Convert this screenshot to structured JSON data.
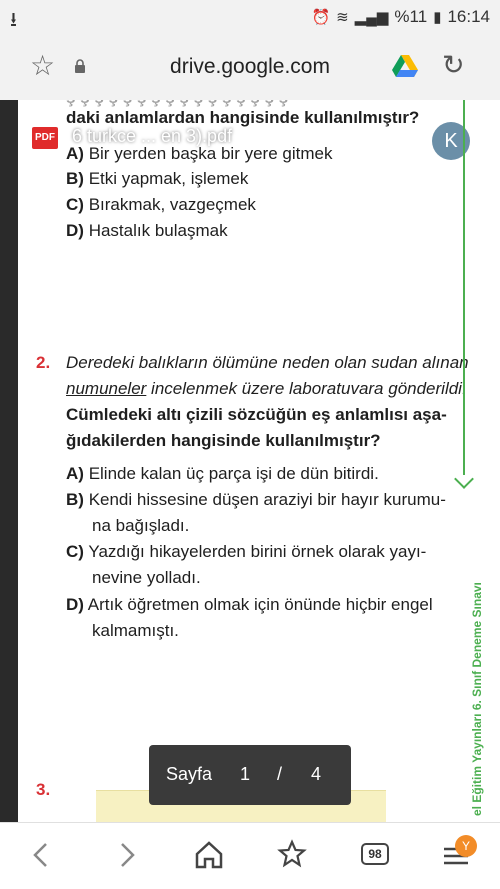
{
  "status_bar": {
    "left_icon": "download-arrow-icon",
    "battery_percent": "%11",
    "time": "16:14"
  },
  "browser": {
    "url": "drive.google.com"
  },
  "pdf": {
    "file_name": "6 turkce ... en 3).pdf",
    "badge": "PDF",
    "avatar_letter": "K"
  },
  "question1": {
    "stem_tail": "daki anlamlardan hangisinde kullanılmıştır?",
    "options": [
      {
        "letter": "A)",
        "text": "Bir yerden başka bir yere gitmek"
      },
      {
        "letter": "B)",
        "text": "Etki yapmak, işlemek"
      },
      {
        "letter": "C)",
        "text": "Bırakmak, vazgeçmek"
      },
      {
        "letter": "D)",
        "text": "Hastalık bulaşmak"
      }
    ]
  },
  "question2": {
    "number": "2.",
    "line1": "Deredeki balıkların ölümüne neden olan sudan alınan",
    "underlined_word": "numuneler",
    "line2_rest": " incelenmek üzere laboratuvara gönderildi.",
    "bold_line1": "Cümledeki altı çizili sözcüğün eş anlamlısı aşa-",
    "bold_line2": "ğıdakilerden hangisinde kullanılmıştır?",
    "options": [
      {
        "letter": "A)",
        "line1": "Elinde kalan üç parça işi de dün bitirdi.",
        "line2": ""
      },
      {
        "letter": "B)",
        "line1": "Kendi hissesine düşen araziyi bir hayır kurumu-",
        "line2": "na bağışladı."
      },
      {
        "letter": "C)",
        "line1": "Yazdığı hikayelerden birini örnek olarak yayı-",
        "line2": "nevine yolladı."
      },
      {
        "letter": "D)",
        "line1": "Artık öğretmen olmak için önünde hiçbir engel",
        "line2": "kalmamıştı."
      }
    ]
  },
  "question3": {
    "number": "3."
  },
  "side_label": "el Eğitim Yayınları 6. Sınıf Deneme Sınavı",
  "page_indicator": {
    "label": "Sayfa",
    "current": "1",
    "separator": "/",
    "total": "4"
  },
  "bottom_nav": {
    "tab_count": "98",
    "menu_badge": "Y"
  },
  "colors": {
    "accent_red": "#d93035",
    "side_green": "#4caf50",
    "pdf_red": "#e02b2b"
  }
}
